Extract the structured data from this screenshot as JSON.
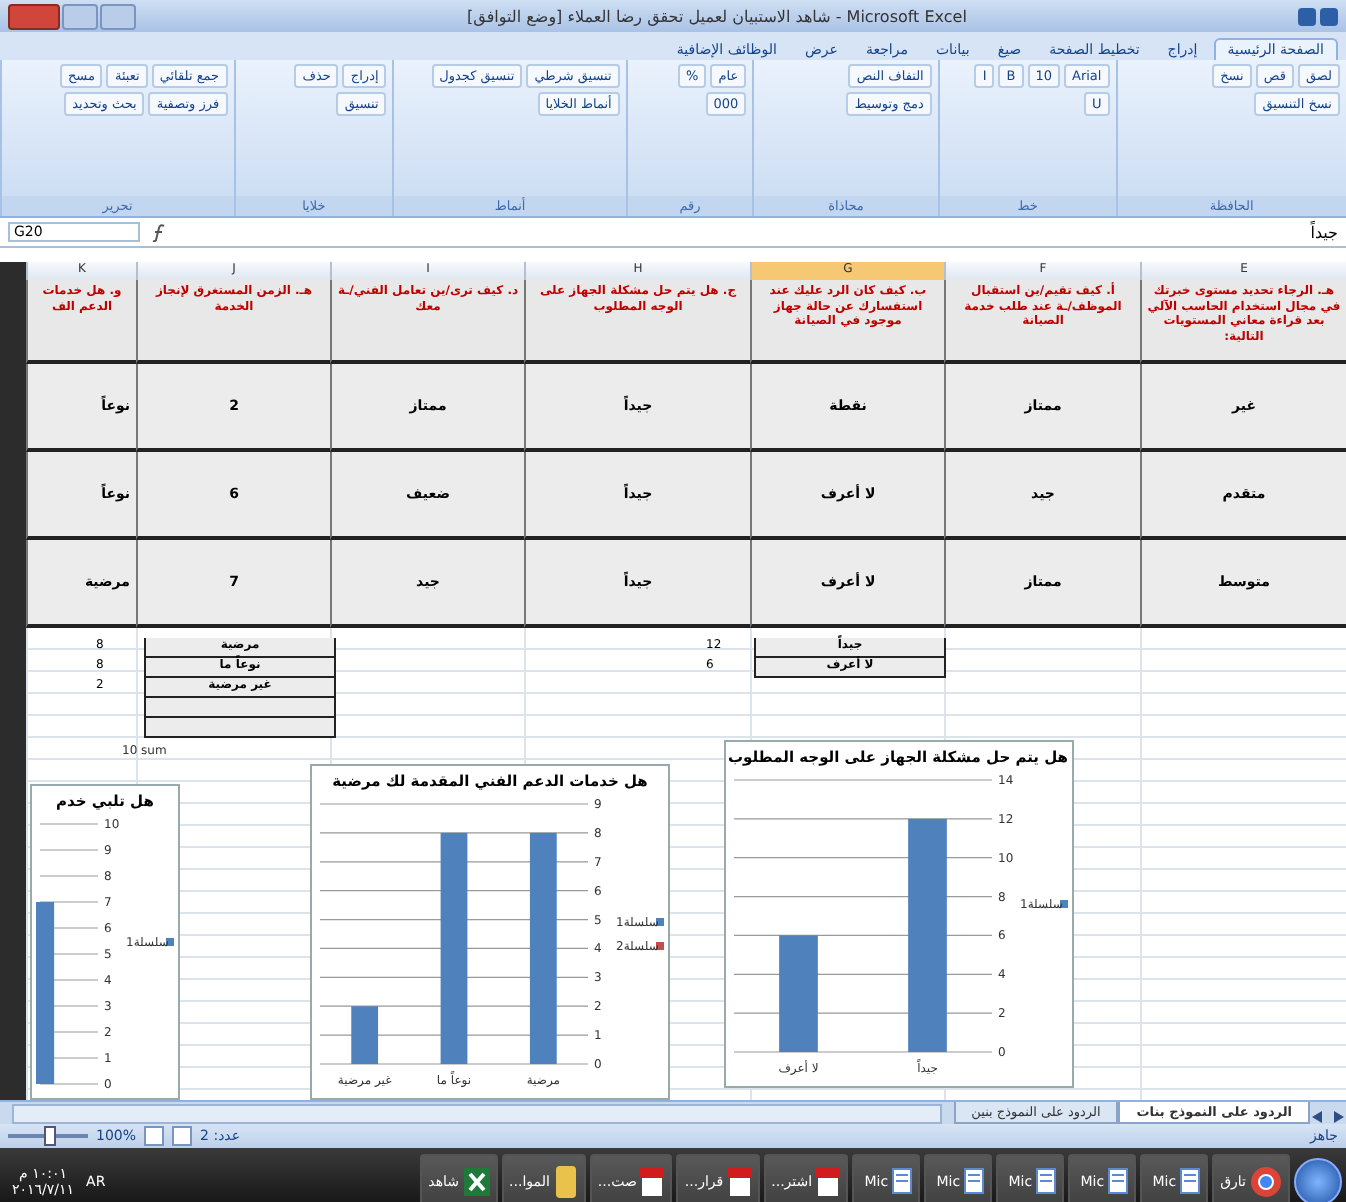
{
  "window": {
    "title": "شاهد الاستبيان لعميل تحقق رضا العملاء [وضع التوافق] - Microsoft Excel"
  },
  "ribbon_tabs": [
    {
      "label": "الصفحة الرئيسية",
      "selected": true
    },
    {
      "label": "إدراج",
      "selected": false
    },
    {
      "label": "تخطيط الصفحة",
      "selected": false
    },
    {
      "label": "صيغ",
      "selected": false
    },
    {
      "label": "بيانات",
      "selected": false
    },
    {
      "label": "مراجعة",
      "selected": false
    },
    {
      "label": "عرض",
      "selected": false
    },
    {
      "label": "الوظائف الإضافية",
      "selected": false
    }
  ],
  "ribbon_groups": [
    {
      "label": "الحافظة",
      "buttons": [
        "لصق",
        "قص",
        "نسخ",
        "نسخ التنسيق"
      ]
    },
    {
      "label": "خط",
      "buttons": [
        "Arial",
        "10",
        "B",
        "I",
        "U"
      ]
    },
    {
      "label": "محاذاة",
      "buttons": [
        "التفاف النص",
        "دمج وتوسيط"
      ]
    },
    {
      "label": "رقم",
      "buttons": [
        "عام",
        "%",
        "000"
      ]
    },
    {
      "label": "أنماط",
      "buttons": [
        "تنسيق شرطي",
        "تنسيق كجدول",
        "أنماط الخلايا"
      ]
    },
    {
      "label": "خلايا",
      "buttons": [
        "إدراج",
        "حذف",
        "تنسيق"
      ]
    },
    {
      "label": "تحرير",
      "buttons": [
        "جمع تلقائي",
        "تعبئة",
        "مسح",
        "فرز وتصفية",
        "بحث وتحديد"
      ]
    }
  ],
  "formula_bar": {
    "name_box": "G20",
    "value": "جيداً"
  },
  "columns": [
    {
      "letter": "E",
      "selected": false
    },
    {
      "letter": "F",
      "selected": false
    },
    {
      "letter": "G",
      "selected": true
    },
    {
      "letter": "H",
      "selected": false
    },
    {
      "letter": "I",
      "selected": false
    },
    {
      "letter": "J",
      "selected": false
    },
    {
      "letter": "K",
      "selected": false
    }
  ],
  "header_row": [
    "هـ. الرجاء تحديد مستوى خبرتك في مجال استخدام الحاسب الآلي بعد قراءة معاني المستويات التالية:",
    "أ. كيف تقيم/ين استقبال الموظف/ـة عند طلب خدمة الصيانة",
    "ب. كيف كان الرد عليك عند استفسارك عن حالة جهاز موجود في الصيانة",
    "ج. هل يتم حل مشكلة الجهاز على الوجه المطلوب",
    "د. كيف ترى/ين تعامل الفني/ـة معك",
    "هـ. الزمن المستغرق لإنجاز الخدمة",
    "و. هل خدمات الدعم الف"
  ],
  "rows": [
    [
      "غير",
      "ممتاز",
      "نقطة",
      "جيداً",
      "ممتاز",
      "2",
      "نوعاً"
    ],
    [
      "متقدم",
      "جيد",
      "لا أعرف",
      "جيداً",
      "ضعيف",
      "6",
      "نوعاً"
    ],
    [
      "متوسط",
      "ممتاز",
      "لا أعرف",
      "جيداً",
      "جيد",
      "7",
      "مرضية"
    ]
  ],
  "summary_tables": [
    {
      "rows": [
        {
          "count": "12",
          "label": "جيداً"
        },
        {
          "count": "6",
          "label": "لا أعرف"
        }
      ]
    },
    {
      "rows": [
        {
          "count": "8",
          "label": "مرضية"
        },
        {
          "count": "8",
          "label": "نوعاً ما"
        },
        {
          "count": "2",
          "label": "غير مرضية"
        },
        {},
        {}
      ]
    }
  ],
  "sum_note": "10 sum",
  "charts": [
    {
      "chart_data": {
        "type": "bar",
        "title": "هل يتم حل مشكلة الجهاز على الوجه المطلوب",
        "categories": [
          "لا أعرف",
          "جيداً"
        ],
        "series": [
          {
            "name": "سلسلة1",
            "color": "#4f81bd",
            "values": [
              6,
              12
            ]
          }
        ],
        "grid": true,
        "ylim": [
          0,
          14
        ],
        "yticks": [
          0,
          2,
          4,
          6,
          8,
          10,
          12,
          14
        ]
      }
    },
    {
      "chart_data": {
        "type": "bar",
        "title": "هل خدمات الدعم الفني المقدمة لك مرضية",
        "categories": [
          "غير مرضية",
          "نوعاً ما",
          "مرضية"
        ],
        "series": [
          {
            "name": "سلسلة1",
            "color": "#4f81bd",
            "values": [
              2,
              8,
              8
            ]
          },
          {
            "name": "سلسلة2",
            "color": "#c0504d",
            "values": [
              null,
              null,
              null
            ]
          }
        ],
        "grid": true,
        "ylim": [
          0,
          9
        ],
        "yticks": [
          0,
          1,
          2,
          3,
          4,
          5,
          6,
          7,
          8,
          9
        ]
      }
    },
    {
      "chart_data": {
        "type": "bar",
        "title": "هل تلبي خدم",
        "series": [
          {
            "name": "سلسلة1",
            "color": "#4f81bd",
            "values": [
              7
            ]
          }
        ],
        "grid": true,
        "ylim": [
          0,
          10
        ],
        "yticks": [
          0,
          1,
          2,
          3,
          4,
          5,
          6,
          7,
          8,
          9,
          10
        ]
      }
    }
  ],
  "sheet_tabs": [
    {
      "label": "الردود على النموذج بنات",
      "selected": true
    },
    {
      "label": "الردود على النموذج بنين",
      "selected": false
    }
  ],
  "status_bar": {
    "ready": "جاهز",
    "count": "عدد: 2",
    "zoom": "100%",
    "zoom_slider": {
      "level": 0.5
    }
  },
  "taskbar": {
    "items": [
      {
        "kind": "browser",
        "label": "تارق"
      },
      {
        "kind": "word",
        "label": "Mic"
      },
      {
        "kind": "word",
        "label": "Mic"
      },
      {
        "kind": "word",
        "label": "Mic"
      },
      {
        "kind": "word",
        "label": "Mic"
      },
      {
        "kind": "word",
        "label": "Mic"
      },
      {
        "kind": "pdf",
        "label": "اشتر..."
      },
      {
        "kind": "pdf",
        "label": "قرار..."
      },
      {
        "kind": "pdf",
        "label": "صت..."
      },
      {
        "kind": "folder",
        "label": "الموا..."
      },
      {
        "kind": "excel",
        "label": "شاهد"
      }
    ],
    "language": "AR",
    "time": "١٠:٠١ م",
    "date": "٢٠١٦/٧/١١"
  }
}
